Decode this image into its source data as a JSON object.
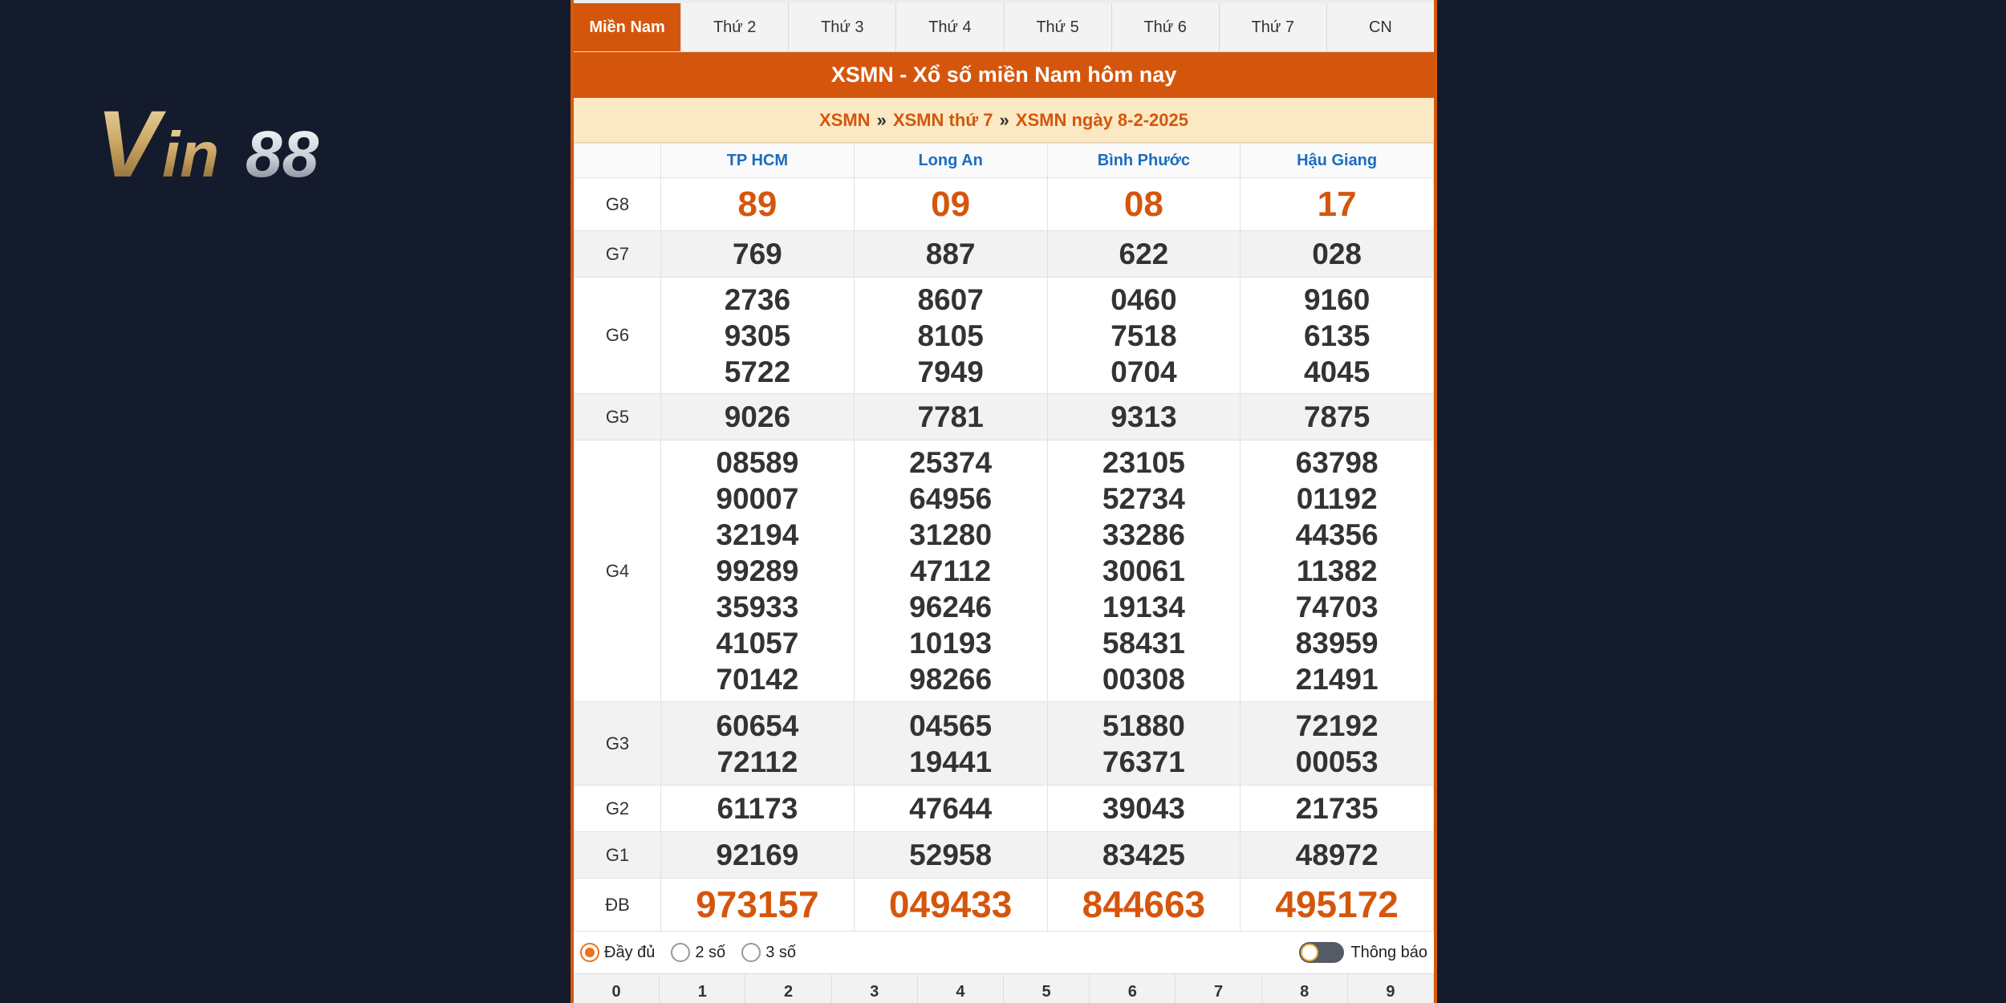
{
  "logo": {
    "text": "Vin88"
  },
  "tabs": [
    {
      "label": "Miền Nam",
      "active": true
    },
    {
      "label": "Thứ 2"
    },
    {
      "label": "Thứ 3"
    },
    {
      "label": "Thứ 4"
    },
    {
      "label": "Thứ 5"
    },
    {
      "label": "Thứ 6"
    },
    {
      "label": "Thứ 7"
    },
    {
      "label": "CN"
    }
  ],
  "title": "XSMN - Xổ số miền Nam hôm nay",
  "breadcrumb": [
    "XSMN",
    "XSMN thứ 7",
    "XSMN ngày 8-2-2025"
  ],
  "breadcrumb_sep": "»",
  "provinces": [
    "TP HCM",
    "Long An",
    "Bình Phước",
    "Hậu Giang"
  ],
  "prizes": [
    {
      "label": "G8",
      "style": "red",
      "values": [
        [
          "89"
        ],
        [
          "09"
        ],
        [
          "08"
        ],
        [
          "17"
        ]
      ]
    },
    {
      "label": "G7",
      "values": [
        [
          "769"
        ],
        [
          "887"
        ],
        [
          "622"
        ],
        [
          "028"
        ]
      ]
    },
    {
      "label": "G6",
      "values": [
        [
          "2736",
          "9305",
          "5722"
        ],
        [
          "8607",
          "8105",
          "7949"
        ],
        [
          "0460",
          "7518",
          "0704"
        ],
        [
          "9160",
          "6135",
          "4045"
        ]
      ]
    },
    {
      "label": "G5",
      "values": [
        [
          "9026"
        ],
        [
          "7781"
        ],
        [
          "9313"
        ],
        [
          "7875"
        ]
      ]
    },
    {
      "label": "G4",
      "values": [
        [
          "08589",
          "90007",
          "32194",
          "99289",
          "35933",
          "41057",
          "70142"
        ],
        [
          "25374",
          "64956",
          "31280",
          "47112",
          "96246",
          "10193",
          "98266"
        ],
        [
          "23105",
          "52734",
          "33286",
          "30061",
          "19134",
          "58431",
          "00308"
        ],
        [
          "63798",
          "01192",
          "44356",
          "11382",
          "74703",
          "83959",
          "21491"
        ]
      ]
    },
    {
      "label": "G3",
      "values": [
        [
          "60654",
          "72112"
        ],
        [
          "04565",
          "19441"
        ],
        [
          "51880",
          "76371"
        ],
        [
          "72192",
          "00053"
        ]
      ]
    },
    {
      "label": "G2",
      "values": [
        [
          "61173"
        ],
        [
          "47644"
        ],
        [
          "39043"
        ],
        [
          "21735"
        ]
      ]
    },
    {
      "label": "G1",
      "values": [
        [
          "92169"
        ],
        [
          "52958"
        ],
        [
          "83425"
        ],
        [
          "48972"
        ]
      ]
    },
    {
      "label": "ĐB",
      "style": "big",
      "values": [
        [
          "973157"
        ],
        [
          "049433"
        ],
        [
          "844663"
        ],
        [
          "495172"
        ]
      ]
    }
  ],
  "options": {
    "radios": [
      {
        "label": "Đầy đủ",
        "checked": true
      },
      {
        "label": "2 số",
        "checked": false
      },
      {
        "label": "3 số",
        "checked": false
      }
    ],
    "notify_label": "Thông báo"
  },
  "digits": [
    "0",
    "1",
    "2",
    "3",
    "4",
    "5",
    "6",
    "7",
    "8",
    "9"
  ],
  "colors": {
    "accent": "#d4560d",
    "province": "#1a6dbf",
    "background": "#141b2d"
  }
}
